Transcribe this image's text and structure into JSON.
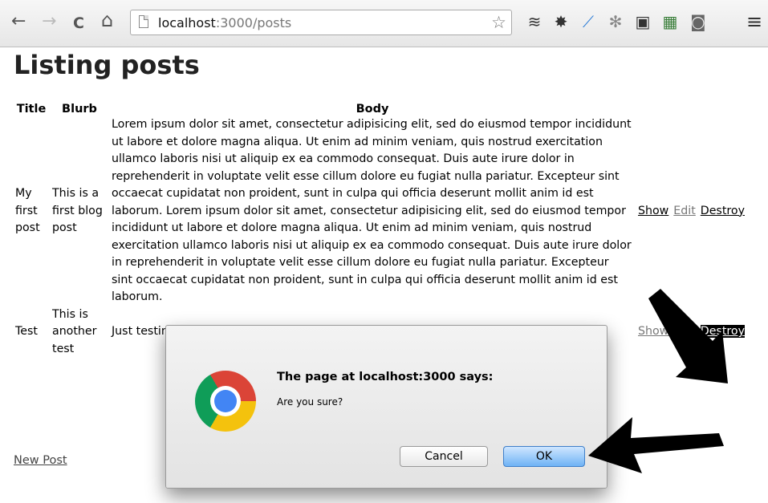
{
  "browser": {
    "back_icon": "←",
    "forward_icon": "→",
    "reload_icon": "C",
    "home_icon": "⌂",
    "url_host": "localhost",
    "url_rest": ":3000/posts",
    "star_icon": "☆",
    "extensions": [
      "≋",
      "✸",
      "⟋",
      "✻",
      "▣",
      "▦",
      "◙",
      "≡"
    ]
  },
  "page": {
    "heading": "Listing posts",
    "columns": [
      "Title",
      "Blurb",
      "Body"
    ],
    "rows": [
      {
        "title": "My first post",
        "blurb": "This is a first blog post",
        "body": "Lorem ipsum dolor sit amet, consectetur adipisicing elit, sed do eiusmod tempor incididunt ut labore et dolore magna aliqua. Ut enim ad minim veniam, quis nostrud exercitation ullamco laboris nisi ut aliquip ex ea commodo consequat. Duis aute irure dolor in reprehenderit in voluptate velit esse cillum dolore eu fugiat nulla pariatur. Excepteur sint occaecat cupidatat non proident, sunt in culpa qui officia deserunt mollit anim id est laborum. Lorem ipsum dolor sit amet, consectetur adipisicing elit, sed do eiusmod tempor incididunt ut labore et dolore magna aliqua. Ut enim ad minim veniam, quis nostrud exercitation ullamco laboris nisi ut aliquip ex ea commodo consequat. Duis aute irure dolor in reprehenderit in voluptate velit esse cillum dolore eu fugiat nulla pariatur. Excepteur sint occaecat cupidatat non proident, sunt in culpa qui officia deserunt mollit anim id est laborum.",
        "show": "Show",
        "edit": "Edit",
        "destroy": "Destroy"
      },
      {
        "title": "Test",
        "blurb": "This is another test",
        "body": "Just testing",
        "show": "Show",
        "edit": "Edit",
        "destroy": "Destroy"
      }
    ],
    "new_post": "New Post"
  },
  "dialog": {
    "title": "The page at localhost:3000 says:",
    "message": "Are you sure?",
    "cancel_label": "Cancel",
    "ok_label": "OK"
  }
}
